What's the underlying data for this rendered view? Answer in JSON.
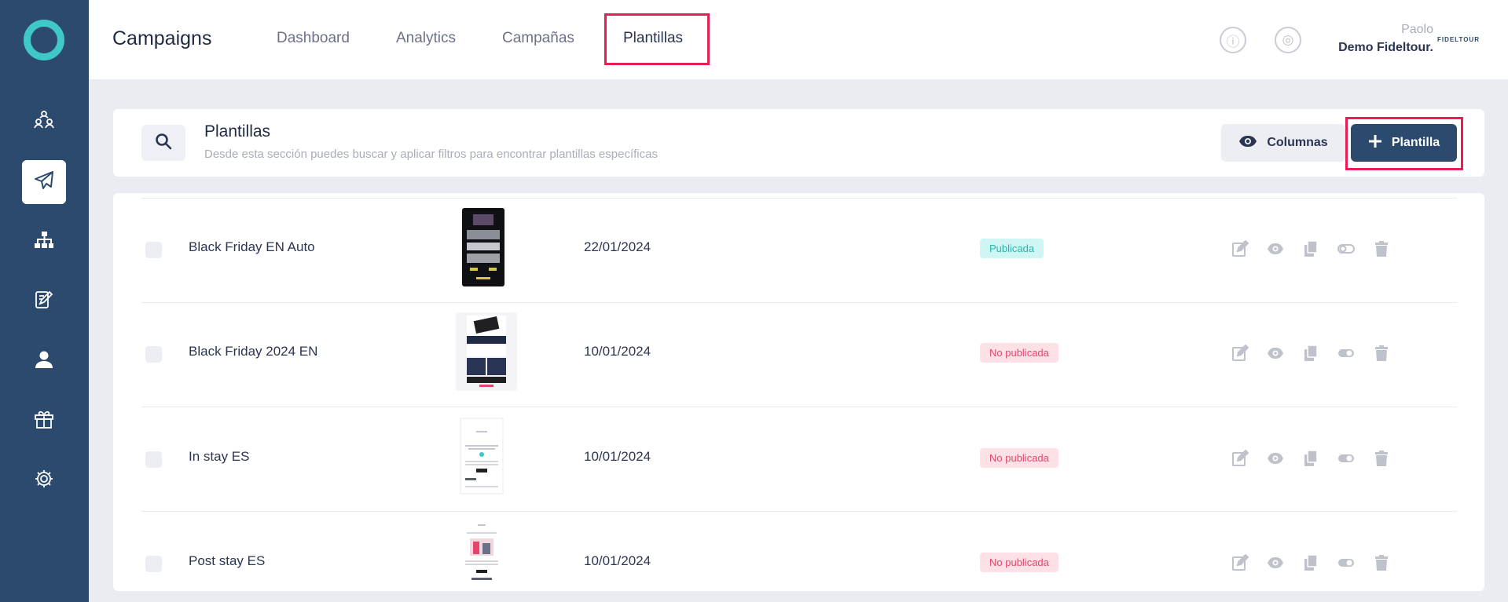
{
  "app": {
    "title": "Campaigns"
  },
  "tabs": [
    {
      "label": "Dashboard"
    },
    {
      "label": "Analytics"
    },
    {
      "label": "Campañas"
    },
    {
      "label": "Plantillas"
    }
  ],
  "user": {
    "name": "Paolo",
    "org": "Demo Fideltour.",
    "brand": "FIDELTOUR"
  },
  "sidebar": {
    "items": [
      {
        "icon": "users-network-icon"
      },
      {
        "icon": "send-icon"
      },
      {
        "icon": "sitemap-icon"
      },
      {
        "icon": "edit-form-icon"
      },
      {
        "icon": "user-icon"
      },
      {
        "icon": "gift-icon"
      },
      {
        "icon": "gear-icon"
      }
    ]
  },
  "header": {
    "title": "Plantillas",
    "subtitle": "Desde esta sección puedes buscar y aplicar filtros para encontrar plantillas específicas",
    "columns_label": "Columnas",
    "add_label": "Plantilla"
  },
  "templates": [
    {
      "name": "Black Friday EN Auto",
      "date": "22/01/2024",
      "status": "Publicada"
    },
    {
      "name": "Black Friday 2024 EN",
      "date": "10/01/2024",
      "status": "No publicada"
    },
    {
      "name": "In stay ES",
      "date": "10/01/2024",
      "status": "No publicada"
    },
    {
      "name": "Post stay ES",
      "date": "10/01/2024",
      "status": "No publicada"
    }
  ],
  "colors": {
    "sidebar": "#2c4a6e",
    "accent": "#3fc7c9",
    "highlight": "#e61f55",
    "published": "#25b6b0",
    "unpublished": "#e5456b"
  }
}
